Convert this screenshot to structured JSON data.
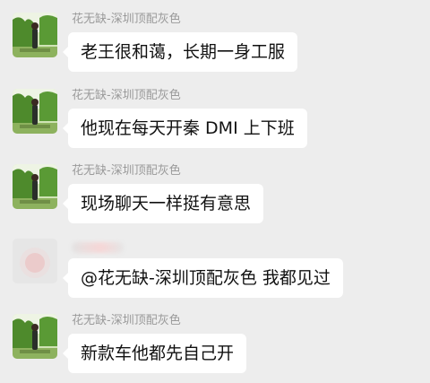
{
  "messages": [
    {
      "sender": "花无缺-深圳顶配灰色",
      "text": "老王很和蔼，长期一身工服",
      "avatar": "green-park-avatar"
    },
    {
      "sender": "花无缺-深圳顶配灰色",
      "text": "他现在每天开秦 DMI 上下班",
      "avatar": "green-park-avatar"
    },
    {
      "sender": "花无缺-深圳顶配灰色",
      "text": "现场聊天一样挺有意思",
      "avatar": "green-park-avatar"
    },
    {
      "sender": "",
      "text": "@花无缺-深圳顶配灰色  我都见过",
      "avatar": "blurred-avatar"
    },
    {
      "sender": "花无缺-深圳顶配灰色",
      "text": "新款车他都先自己开",
      "avatar": "green-park-avatar"
    }
  ],
  "colors": {
    "background": "#ededed",
    "bubble": "#ffffff",
    "sender": "#9a9a9a",
    "text": "#111111"
  }
}
